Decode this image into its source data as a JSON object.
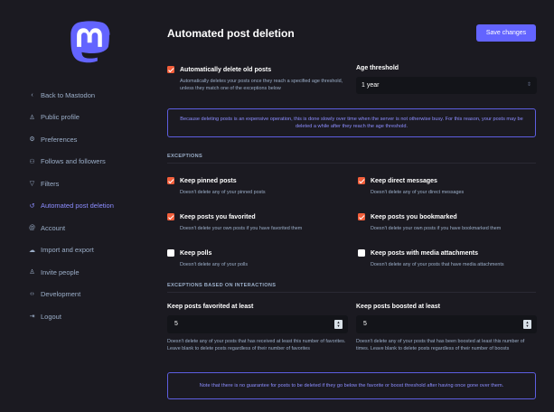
{
  "brand": {
    "accent": "#6364ff",
    "checkbox_on": "#f25e3a",
    "background": "#1b1a21"
  },
  "sidebar": {
    "logo_icon": "mastodon-logo",
    "items": [
      {
        "label": "Back to Mastodon",
        "icon": "chevron-left-icon"
      },
      {
        "label": "Public profile",
        "icon": "person-icon"
      },
      {
        "label": "Preferences",
        "icon": "gear-icon"
      },
      {
        "label": "Follows and followers",
        "icon": "people-icon"
      },
      {
        "label": "Filters",
        "icon": "filter-icon"
      },
      {
        "label": "Automated post deletion",
        "icon": "history-icon",
        "active": true
      },
      {
        "label": "Account",
        "icon": "at-icon"
      },
      {
        "label": "Import and export",
        "icon": "cloud-icon"
      },
      {
        "label": "Invite people",
        "icon": "person-add-icon"
      },
      {
        "label": "Development",
        "icon": "code-icon"
      },
      {
        "label": "Logout",
        "icon": "logout-icon"
      }
    ]
  },
  "header": {
    "title": "Automated post deletion",
    "save_label": "Save changes"
  },
  "auto_delete": {
    "label": "Automatically delete old posts",
    "hint": "Automatically deletes your posts once they reach a specified age threshold, unless they match one of the exceptions below",
    "checked": true
  },
  "age_threshold": {
    "label": "Age threshold",
    "value": "1 year"
  },
  "notice_top": "Because deleting posts is an expensive operation, this is done slowly over time when the server is not otherwise busy. For this reason, your posts may be deleted a while after they reach the age threshold.",
  "exceptions": {
    "heading": "EXCEPTIONS",
    "items": [
      {
        "label": "Keep pinned posts",
        "hint": "Doesn't delete any of your pinned posts",
        "checked": true
      },
      {
        "label": "Keep direct messages",
        "hint": "Doesn't delete any of your direct messages",
        "checked": true
      },
      {
        "label": "Keep posts you favorited",
        "hint": "Doesn't delete your own posts if you have favorited them",
        "checked": true
      },
      {
        "label": "Keep posts you bookmarked",
        "hint": "Doesn't delete your own posts if you have bookmarked them",
        "checked": true
      },
      {
        "label": "Keep polls",
        "hint": "Doesn't delete any of your polls",
        "checked": false
      },
      {
        "label": "Keep posts with media attachments",
        "hint": "Doesn't delete any of your posts that have media attachments",
        "checked": false
      }
    ]
  },
  "interactions": {
    "heading": "EXCEPTIONS BASED ON INTERACTIONS",
    "favorites": {
      "label": "Keep posts favorited at least",
      "value": "5",
      "hint": "Doesn't delete any of your posts that has received at least this number of favorites. Leave blank to delete posts regardless of their number of favorites"
    },
    "boosts": {
      "label": "Keep posts boosted at least",
      "value": "5",
      "hint": "Doesn't delete any of your posts that has been boosted at least this number of times. Leave blank to delete posts regardless of their number of boosts"
    }
  },
  "notice_bottom": "Note that there is no guarantee for posts to be deleted if they go below the favorite or boost threshold after having once gone over them."
}
